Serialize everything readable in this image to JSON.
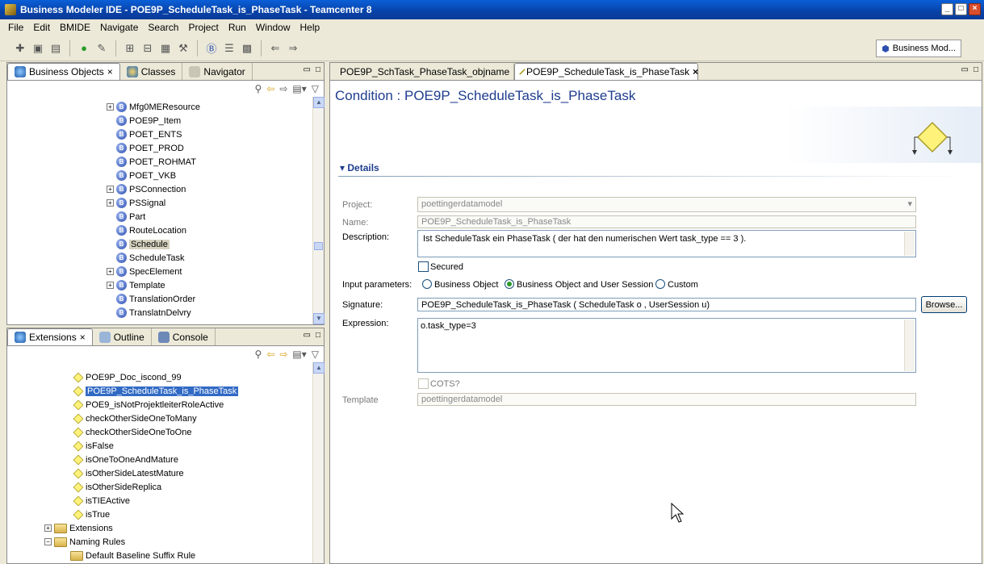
{
  "window": {
    "title": "Business Modeler IDE - POE9P_ScheduleTask_is_PhaseTask - Teamcenter 8",
    "min": "_",
    "max": "□",
    "close": "×"
  },
  "menu": [
    "File",
    "Edit",
    "BMIDE",
    "Navigate",
    "Search",
    "Project",
    "Run",
    "Window",
    "Help"
  ],
  "perspective": {
    "label": "Business Mod..."
  },
  "top_panel": {
    "tabs": [
      {
        "label": "Business Objects",
        "icon": "business-objects-icon",
        "close": "×"
      },
      {
        "label": "Classes",
        "icon": "classes-icon"
      },
      {
        "label": "Navigator",
        "icon": "navigator-icon"
      }
    ],
    "items": [
      {
        "label": "Mfg0MEResource",
        "expand": "+",
        "badge": "B"
      },
      {
        "label": "POE9P_Item",
        "expand": "",
        "badge": "B"
      },
      {
        "label": "POET_ENTS",
        "expand": "",
        "badge": "B"
      },
      {
        "label": "POET_PROD",
        "expand": "",
        "badge": "B"
      },
      {
        "label": "POET_ROHMAT",
        "expand": "",
        "badge": "B"
      },
      {
        "label": "POET_VKB",
        "expand": "",
        "badge": "B"
      },
      {
        "label": "PSConnection",
        "expand": "+",
        "badge": "B"
      },
      {
        "label": "PSSignal",
        "expand": "+",
        "badge": "B"
      },
      {
        "label": "Part",
        "expand": "",
        "badge": "B"
      },
      {
        "label": "RouteLocation",
        "expand": "",
        "badge": "B"
      },
      {
        "label": "Schedule",
        "expand": "",
        "badge": "B",
        "highlight": true
      },
      {
        "label": "ScheduleTask",
        "expand": "",
        "badge": "B"
      },
      {
        "label": "SpecElement",
        "expand": "+",
        "badge": "B"
      },
      {
        "label": "Template",
        "expand": "+",
        "badge": "B"
      },
      {
        "label": "TranslationOrder",
        "expand": "",
        "badge": "B"
      },
      {
        "label": "TranslatnDelvry",
        "expand": "",
        "badge": "B"
      }
    ]
  },
  "bottom_panel": {
    "tabs": [
      {
        "label": "Extensions",
        "icon": "extensions-icon",
        "close": "×"
      },
      {
        "label": "Outline",
        "icon": "outline-icon"
      },
      {
        "label": "Console",
        "icon": "console-icon"
      }
    ],
    "items": [
      {
        "label": "POE9P_Doc_iscond_99",
        "type": "condition"
      },
      {
        "label": "POE9P_ScheduleTask_is_PhaseTask",
        "type": "condition",
        "selected": true
      },
      {
        "label": "POE9_isNotProjektleiterRoleActive",
        "type": "condition"
      },
      {
        "label": "checkOtherSideOneToMany",
        "type": "condition"
      },
      {
        "label": "checkOtherSideOneToOne",
        "type": "condition"
      },
      {
        "label": "isFalse",
        "type": "condition"
      },
      {
        "label": "isOneToOneAndMature",
        "type": "condition"
      },
      {
        "label": "isOtherSideLatestMature",
        "type": "condition"
      },
      {
        "label": "isOtherSideReplica",
        "type": "condition"
      },
      {
        "label": "isTIEActive",
        "type": "condition"
      },
      {
        "label": "isTrue",
        "type": "condition"
      },
      {
        "label": "Extensions",
        "type": "folder",
        "expand": "+"
      },
      {
        "label": "Naming Rules",
        "type": "folder",
        "expand": "−"
      },
      {
        "label": "Default Baseline Suffix Rule",
        "type": "folder",
        "expand": ""
      }
    ]
  },
  "editor": {
    "tabs": [
      {
        "label": "POE9P_SchTask_PhaseTask_objname",
        "icon": "folder-icon"
      },
      {
        "label": "POE9P_ScheduleTask_is_PhaseTask",
        "icon": "condition-icon",
        "close": "×"
      }
    ],
    "heading": "Condition : POE9P_ScheduleTask_is_PhaseTask",
    "section": "Details",
    "labels": {
      "project": "Project:",
      "name": "Name:",
      "description": "Description:",
      "secured": "Secured",
      "input_params": "Input parameters:",
      "signature": "Signature:",
      "expression": "Expression:",
      "cots": "COTS?",
      "template": "Template"
    },
    "values": {
      "project": "poettingerdatamodel",
      "name": "POE9P_ScheduleTask_is_PhaseTask",
      "description": "Ist ScheduleTask ein PhaseTask  ( der hat den numerischen Wert task_type == 3 ).",
      "signature": "POE9P_ScheduleTask_is_PhaseTask ( ScheduleTask o , UserSession u)",
      "expression": "o.task_type=3",
      "template": "poettingerdatamodel"
    },
    "radios": [
      "Business Object",
      "Business Object and User Session",
      "Custom"
    ],
    "selected_radio": 1,
    "browse": "Browse..."
  }
}
